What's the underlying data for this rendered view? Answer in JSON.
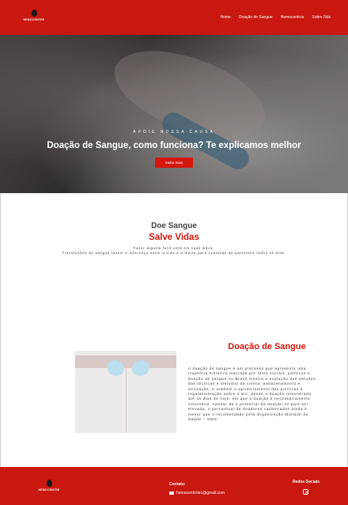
{
  "brand": {
    "logo_text": "HEMOCENTRE",
    "accent": "#c8180f"
  },
  "nav": {
    "items": [
      {
        "label": "Home"
      },
      {
        "label": "Doação de Sangue"
      },
      {
        "label": "Hemocentros"
      },
      {
        "label": "Sobre Nós"
      }
    ]
  },
  "hero": {
    "eyebrow": "APOIE NOSSA CAUSA",
    "title": "Doação de Sangue, como funciona? Te explicamos melhor",
    "cta_label": "Saiba mais"
  },
  "doe": {
    "title": "Doe Sangue",
    "subtitle": "Salve Vidas",
    "line1": "Fazer alguém feliz está em suas mãos.",
    "line2": "Transfusões de sangue fazem a diferença entre a vida e a morte para centenas de pacientes todos os dias."
  },
  "doacao": {
    "title": "Doação de Sangue",
    "text": "A doação de sangue é um processo que apresenta uma trajetória histórica marcada por fatos sociais, políticos e doação de sangue no Brasil mostra a evolução dos estudos, das técnicas e métodos de coleta, armazenamento e utilização, e também o aprimoramento das políticas e regulamentação sobre o ato, desde a doação remunerada até os dias de hoje, em que a doação é necessariamente voluntária. Apesar de o potencial de doação no país ser elevado, o percentual de doadores cadastrados ainda é menor que o recomendado pela Organização Mundial de Saúde – OMS."
  },
  "footer": {
    "logo_text": "HEMOCENTRE",
    "contact_title": "Contato:",
    "contact_email": "hemocentrotec@gmail.com",
    "social_title": "Redes Sociais",
    "social_icon": "instagram-icon"
  }
}
